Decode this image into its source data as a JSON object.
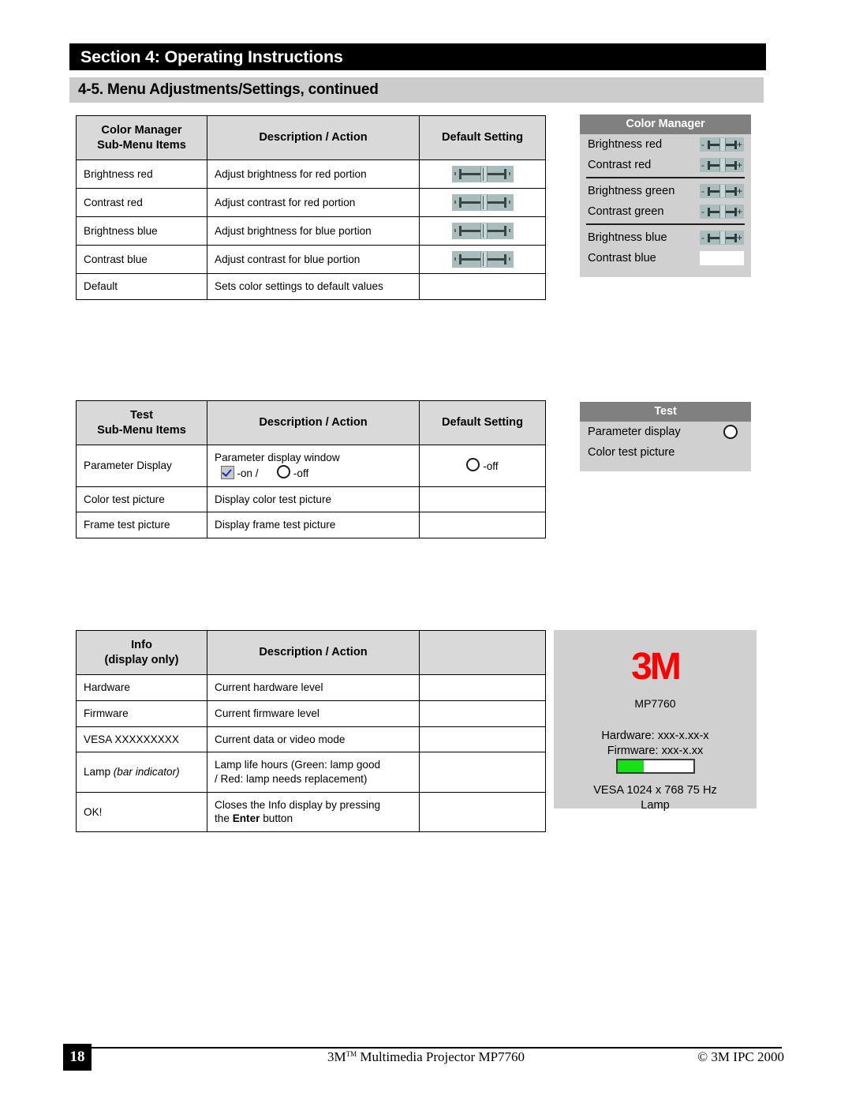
{
  "header": {
    "section_title": "Section 4: Operating Instructions",
    "subsection_title": "4-5.  Menu Adjustments/Settings, continued"
  },
  "colors": {
    "section_bar_bg": "#000000",
    "subsection_bar_bg": "#cccccc",
    "table_header_bg": "#d9d9d9",
    "osd_title_bg": "#808080",
    "osd_body_bg": "#d0d0d0",
    "slider_chip_bg": "#a9bdbd",
    "logo_red": "#ff0000",
    "lamp_green": "#16e016"
  },
  "tables": {
    "color_manager": {
      "headers": [
        "Color Manager\nSub-Menu Items",
        "Description / Action",
        "Default Setting"
      ],
      "header_line1": "Color Manager",
      "header_line2": "Sub-Menu Items",
      "header_desc": "Description / Action",
      "header_default": "Default Setting",
      "rows": [
        {
          "item": "Brightness red",
          "desc": "Adjust brightness for red portion",
          "default_icon": "slider-icon"
        },
        {
          "item": "Contrast red",
          "desc": "Adjust contrast for red portion",
          "default_icon": "slider-icon"
        },
        {
          "item": "Brightness blue",
          "desc": "Adjust brightness for blue portion",
          "default_icon": "slider-icon"
        },
        {
          "item": "Contrast blue",
          "desc": "Adjust contrast for blue portion",
          "default_icon": "slider-icon"
        },
        {
          "item": "Default",
          "desc": "Sets color settings to default values",
          "default_icon": ""
        }
      ]
    },
    "test": {
      "header_line1": "Test",
      "header_line2": "Sub-Menu Items",
      "header_desc": "Description / Action",
      "header_default": "Default Setting",
      "rows": [
        {
          "item": "Parameter Display",
          "desc": "Parameter display window",
          "desc_option_on": "-on /",
          "desc_option_off": "-off",
          "default_text": "-off"
        },
        {
          "item": "Color test picture",
          "desc": "Display color test picture",
          "default_text": ""
        },
        {
          "item": "Frame test picture",
          "desc": "Display frame test picture",
          "default_text": ""
        }
      ]
    },
    "info": {
      "header_line1": "Info",
      "header_line2": "(display only)",
      "header_desc": "Description / Action",
      "header_blank": "",
      "rows": [
        {
          "item": "Hardware",
          "item_italic": "",
          "desc": "Current hardware level",
          "desc2": ""
        },
        {
          "item": "Firmware",
          "item_italic": "",
          "desc": "Current firmware level",
          "desc2": ""
        },
        {
          "item": "VESA XXXXXXXXX",
          "item_italic": "",
          "desc": "Current data or video mode",
          "desc2": ""
        },
        {
          "item": "Lamp ",
          "item_italic": "(bar indicator)",
          "desc": "Lamp life hours (Green:  lamp good",
          "desc2": "/ Red:  lamp needs replacement)"
        },
        {
          "item": "OK!",
          "item_italic": "",
          "desc": "Closes the Info display by pressing",
          "desc2_pre": "the ",
          "desc2_bold": "Enter",
          "desc2_post": " button"
        }
      ]
    }
  },
  "osd": {
    "color_manager": {
      "title": "Color Manager",
      "rows": [
        {
          "label": "Brightness red",
          "widget": "slider-icon"
        },
        {
          "label": "Contrast red",
          "widget": "slider-icon"
        },
        {
          "label": "Brightness green",
          "widget": "slider-icon"
        },
        {
          "label": "Contrast green",
          "widget": "slider-icon"
        },
        {
          "label": "Brightness blue",
          "widget": "slider-icon"
        },
        {
          "label": "Contrast blue",
          "widget": "slider-icon-blank"
        }
      ]
    },
    "test": {
      "title": "Test",
      "rows": [
        {
          "label": "Parameter display",
          "widget": "radio-icon"
        },
        {
          "label": "Color test picture",
          "widget": ""
        }
      ]
    }
  },
  "info_panel": {
    "logo": "3M",
    "model": "MP7760",
    "hardware": "Hardware: xxx-x.xx-x",
    "firmware": "Firmware: xxx-x.xx",
    "lamp_bar_percent": 35,
    "vesa": "VESA 1024 x 768  75 Hz",
    "lamp_label": "Lamp"
  },
  "footer": {
    "page_number": "18",
    "center_pre": "3M",
    "center_tm": "TM",
    "center_post": " Multimedia Projector MP7760",
    "right": "© 3M IPC 2000"
  }
}
